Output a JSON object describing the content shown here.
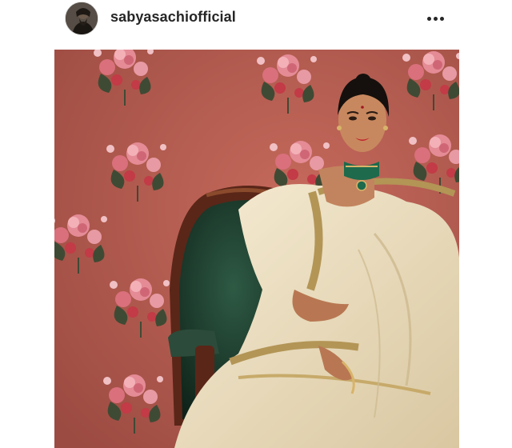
{
  "post": {
    "username": "sabyasachiofficial",
    "avatar_icon": "profile-photo-avatar",
    "more_icon": "more-options-icon",
    "photo_description_icon": "post-photo"
  },
  "colors": {
    "wallpaper": "#b25a4f",
    "saree": "#efe3c6",
    "chair_velvet": "#1f3a2c",
    "chair_wood": "#5a2618",
    "choker_emerald": "#1d6a4c",
    "lips": "#c0202a"
  }
}
